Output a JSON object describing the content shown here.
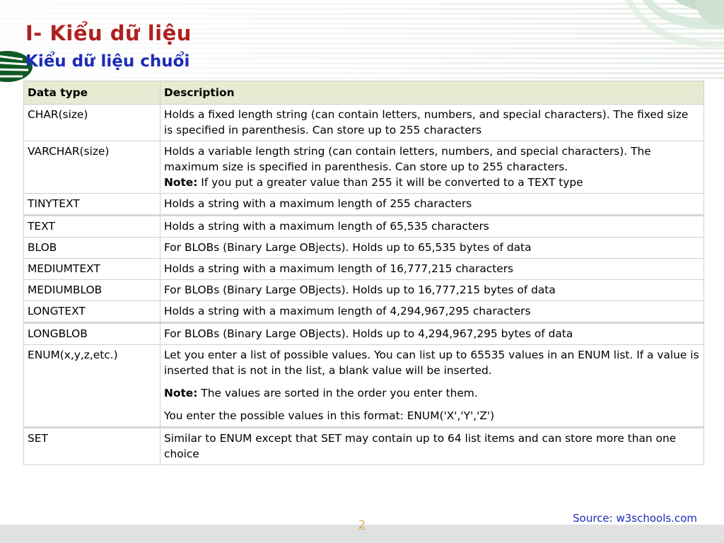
{
  "slide": {
    "title": "I- Kiểu dữ liệu",
    "subtitle": "Kiểu dữ liệu chuổi",
    "source": "Source: w3schools.com",
    "page_number": "2"
  },
  "colors": {
    "title": "#b02020",
    "subtitle": "#1c2bb8",
    "header_bg": "#e7ebd2",
    "accent_green": "#0f5a24",
    "page_number": "#d8b45a"
  },
  "table": {
    "headers": [
      "Data type",
      "Description"
    ],
    "rows": [
      {
        "type": "CHAR(size)",
        "desc": [
          "Holds a fixed length string (can contain letters, numbers, and special characters). The fixed size is specified in parenthesis. Can store up to 255 characters"
        ]
      },
      {
        "type": "VARCHAR(size)",
        "desc": [
          "Holds a variable length string (can contain letters, numbers, and special characters). The maximum size is specified in parenthesis. Can store up to 255 characters."
        ],
        "note_label": "Note:",
        "note": " If you put a greater value than 255 it will be converted to a TEXT type"
      },
      {
        "type": "TINYTEXT",
        "desc": [
          "Holds a string with a maximum length of 255 characters"
        ]
      },
      {
        "type": "TEXT",
        "desc": [
          "Holds a string with a maximum length of 65,535 characters"
        ],
        "thick": true
      },
      {
        "type": "BLOB",
        "desc": [
          "For BLOBs (Binary Large OBjects). Holds up to 65,535 bytes of data"
        ]
      },
      {
        "type": "MEDIUMTEXT",
        "desc": [
          "Holds a string with a maximum length of 16,777,215 characters"
        ]
      },
      {
        "type": "MEDIUMBLOB",
        "desc": [
          "For BLOBs (Binary Large OBjects). Holds up to 16,777,215 bytes of data"
        ]
      },
      {
        "type": "LONGTEXT",
        "desc": [
          "Holds a string with a maximum length of 4,294,967,295 characters"
        ]
      },
      {
        "type": "LONGBLOB",
        "desc": [
          "For BLOBs (Binary Large OBjects). Holds up to 4,294,967,295 bytes of data"
        ],
        "thick": true
      },
      {
        "type": "ENUM(x,y,z,etc.)",
        "desc": [
          "Let you enter a list of possible values. You can list up to 65535 values in an ENUM list. If a value is inserted that is not in the list, a blank value will be inserted."
        ],
        "note_label": "Note:",
        "note": " The values are sorted in the order you enter them.",
        "extra": "You enter the possible values in this format: ENUM('X','Y','Z')"
      },
      {
        "type": "SET",
        "desc": [
          "Similar to ENUM except that SET may contain up to 64 list items and can store more than one choice"
        ],
        "thick": true
      }
    ]
  }
}
